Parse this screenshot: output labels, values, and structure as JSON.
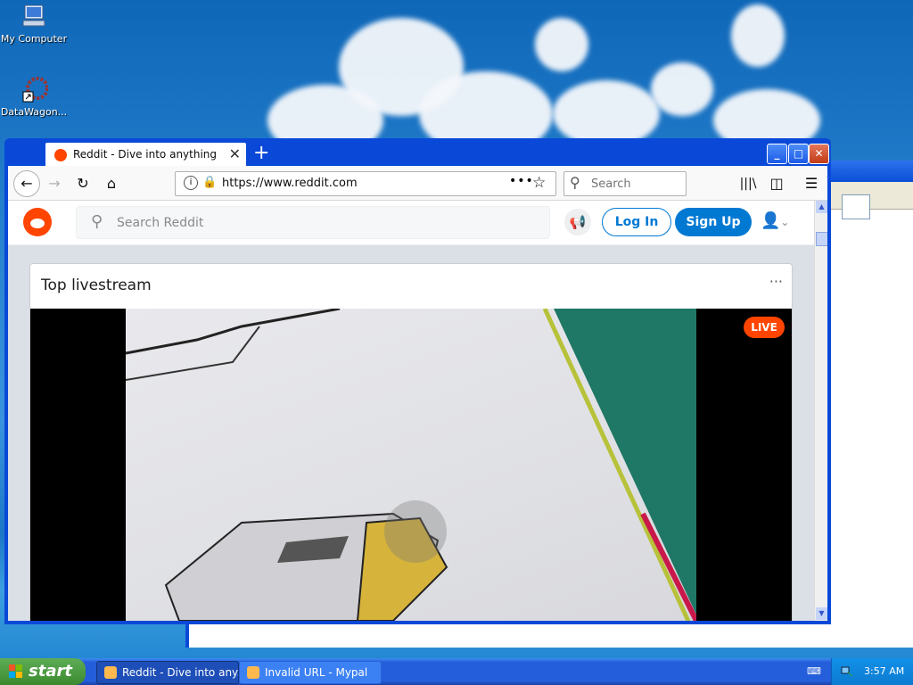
{
  "desktop": {
    "icons": [
      {
        "label": "My Computer",
        "icon": "my-computer-icon"
      },
      {
        "label": "DataWagon...",
        "icon": "datawagon-icon"
      }
    ]
  },
  "browser": {
    "tab": {
      "title": "Reddit - Dive into anything",
      "close": "✕"
    },
    "new_tab": "+",
    "window_buttons": {
      "minimize": "_",
      "maximize": "□",
      "close": "✕"
    },
    "url": "https://www.reddit.com",
    "url_dots": "•••",
    "search_placeholder": "Search"
  },
  "reddit": {
    "search_placeholder": "Search Reddit",
    "login_label": "Log In",
    "signup_label": "Sign Up",
    "card_title": "Top livestream",
    "card_menu": "···",
    "live_badge": "LIVE"
  },
  "taskbar": {
    "start_label": "start",
    "tasks": [
      {
        "label": "Reddit - Dive into any...",
        "active": true
      },
      {
        "label": "Invalid URL - Mypal",
        "active": false
      }
    ],
    "clock": "3:57 AM"
  },
  "colors": {
    "reddit_orange": "#ff4500",
    "reddit_blue": "#0079d3",
    "xp_titlebar": "#0a49d8"
  }
}
